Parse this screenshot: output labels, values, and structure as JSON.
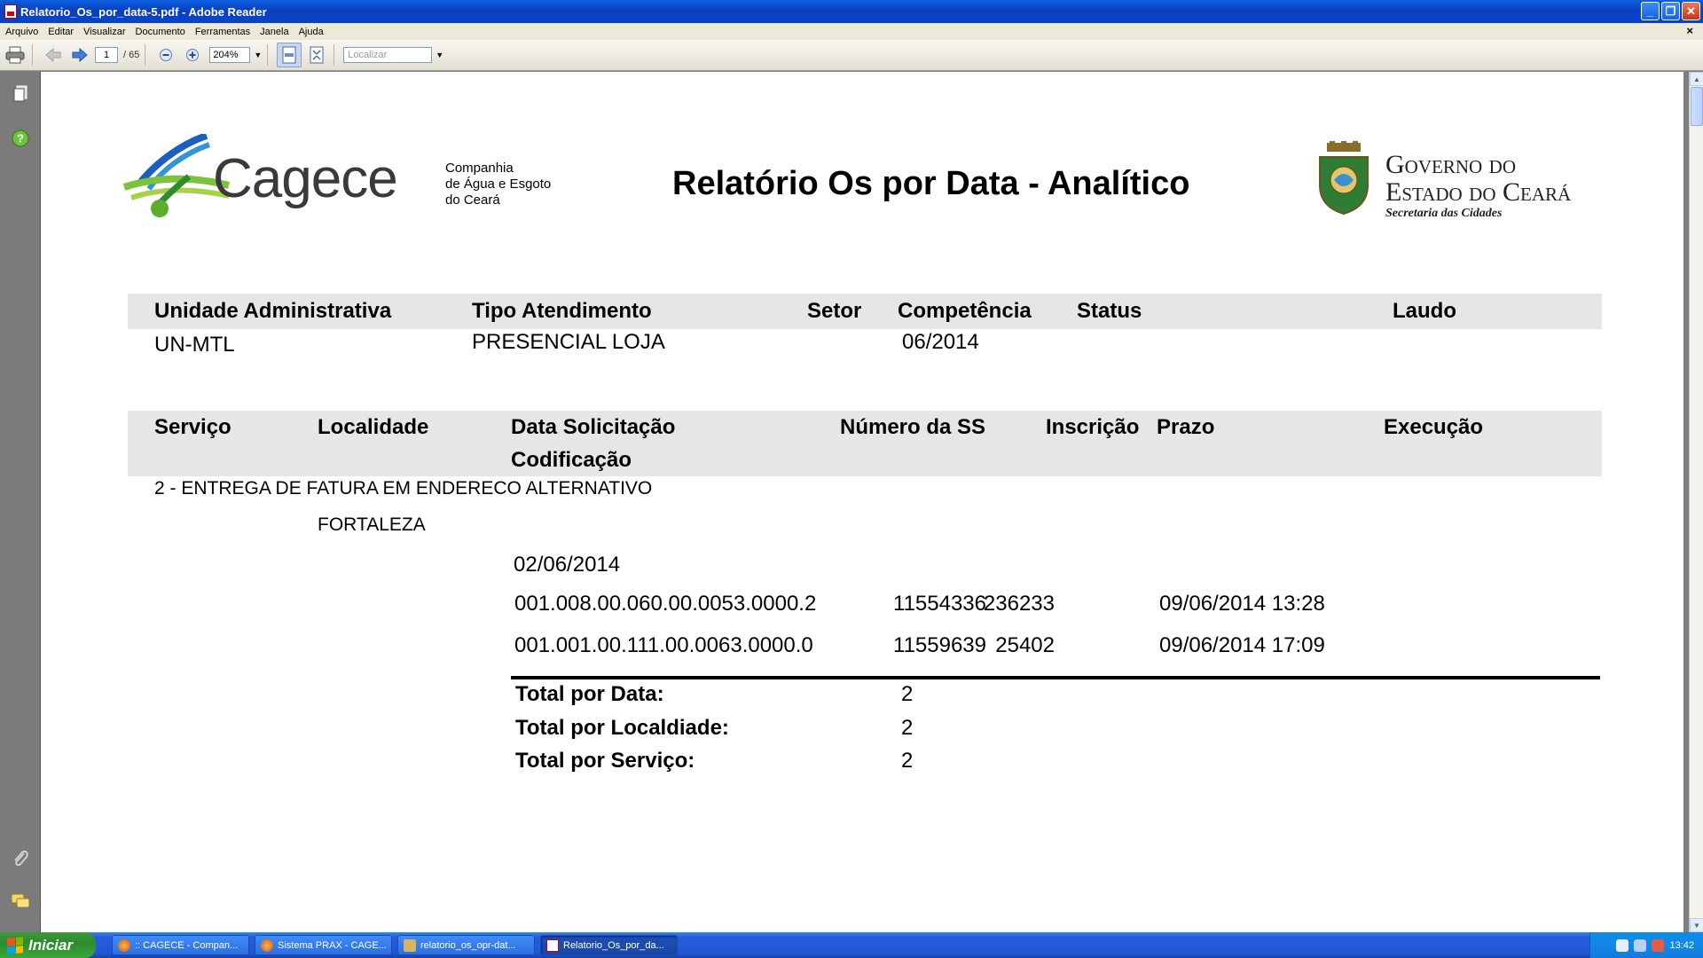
{
  "window": {
    "title": "Relatorio_Os_por_data-5.pdf - Adobe Reader",
    "buttons": {
      "minimize": "_",
      "restore": "❐",
      "close": "✕"
    }
  },
  "menu": [
    "Arquivo",
    "Editar",
    "Visualizar",
    "Documento",
    "Ferramentas",
    "Janela",
    "Ajuda"
  ],
  "menu_close": "×",
  "toolbar": {
    "page_current": "1",
    "page_total": "/ 65",
    "zoom": "204%",
    "find_placeholder": "Localizar"
  },
  "report": {
    "logo_text": "Cagece",
    "company_line1": "Companhia",
    "company_line2": "de Água e Esgoto",
    "company_line3": "do Ceará",
    "title": "Relatório Os por Data - Analítico",
    "gov_line1": "Governo do",
    "gov_line2": "Estado do Ceará",
    "gov_line3": "Secretaria das Cidades",
    "header1": {
      "unidade": "Unidade Administrativa",
      "tipo": "Tipo Atendimento",
      "setor": "Setor",
      "competencia": "Competência",
      "status": "Status",
      "laudo": "Laudo"
    },
    "row1": {
      "unidade": "UN-MTL",
      "tipo": "PRESENCIAL LOJA",
      "competencia": "06/2014"
    },
    "header2": {
      "servico": "Serviço",
      "localidade": "Localidade",
      "data_solicitacao": "Data Solicitação",
      "codificacao": "Codificação",
      "numero_ss": "Número da SS",
      "inscricao": "Inscrição",
      "prazo": "Prazo",
      "execucao": "Execução"
    },
    "servico_nome": "2 - ENTREGA DE FATURA EM ENDERECO ALTERNATIVO",
    "localidade_nome": "FORTALEZA",
    "data": "02/06/2014",
    "rows": [
      {
        "codificacao": "001.008.00.060.00.0053.0000.2",
        "numero_ss": "11554336",
        "inscricao": "236233",
        "prazo": "09/06/2014 13:28"
      },
      {
        "codificacao": "001.001.00.111.00.0063.0000.0",
        "numero_ss": "11559639",
        "inscricao": "25402",
        "prazo": "09/06/2014 17:09"
      }
    ],
    "totals": [
      {
        "label": "Total por Data:",
        "value": "2"
      },
      {
        "label": "Total por Localdiade:",
        "value": "2"
      },
      {
        "label": "Total por Serviço:",
        "value": "2"
      }
    ]
  },
  "taskbar": {
    "start": "Iniciar",
    "items": [
      ":: CAGECE - Compan...",
      "Sistema PRAX - CAGE...",
      "relatorio_os_opr-dat...",
      "Relatorio_Os_por_da..."
    ],
    "clock": "13:42"
  }
}
